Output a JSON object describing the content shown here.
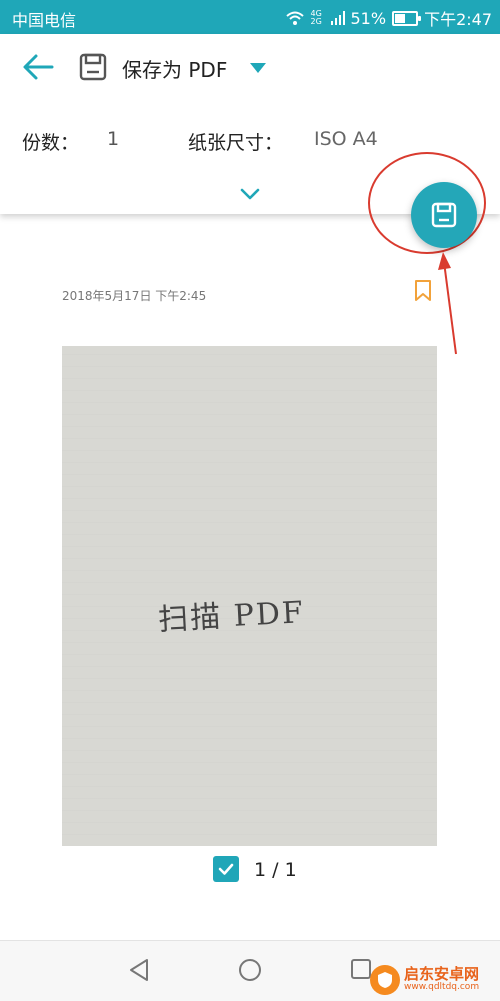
{
  "status_bar": {
    "carrier": "中国电信",
    "network": "4G 2G",
    "battery": "51%",
    "battery_level": 0.51,
    "time": "下午2:47"
  },
  "header": {
    "printer_name": "保存为 PDF",
    "copies_label": "份数：",
    "copies_value": "1",
    "paper_label": "纸张尺寸：",
    "paper_value": "ISO A4"
  },
  "preview": {
    "timestamp": "2018年5月17日 下午2:45",
    "handwriting": "扫描 PDF",
    "page_count": "1 / 1",
    "selected": true
  },
  "watermark": {
    "title": "启东安卓网",
    "url": "www.qdltdq.com"
  },
  "colors": {
    "accent": "#24a7b8",
    "annotation": "#d93b2f",
    "bookmark": "#f2a23a"
  },
  "icons": [
    "back-arrow-icon",
    "save-icon",
    "chevron-down-icon",
    "bookmark-icon",
    "checkbox-checked-icon",
    "nav-back-icon",
    "nav-home-icon",
    "nav-recent-icon"
  ]
}
